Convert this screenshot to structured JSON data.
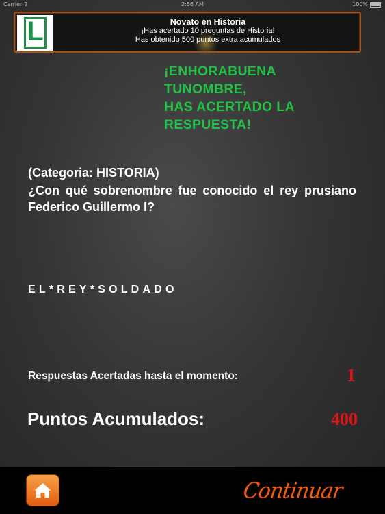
{
  "status_bar": {
    "carrier": "Carrier ⊽",
    "time": "2:56 AM",
    "battery": "100%"
  },
  "banner": {
    "badge_letter": "L",
    "title": "Novato en Historia",
    "line1": "¡Has acertado 10 preguntas de Historia!",
    "line2": "Has obtenido 500 puntos extra acumulados"
  },
  "congrats": {
    "line1": "¡ENHORABUENA",
    "line2": "TUNOMBRE,",
    "line3": "HAS ACERTADO LA",
    "line4": "RESPUESTA!"
  },
  "question": {
    "category": "(Categoria: HISTORIA)",
    "text": "¿Con qué sobrenombre fue conocido el rey prusiano Federico Guillermo I?"
  },
  "answer": "EL*REY*SOLDADO",
  "stats": {
    "correct_label": "Respuestas Acertadas hasta el momento:",
    "correct_value": "1",
    "points_label": "Puntos Acumulados:",
    "points_value": "400"
  },
  "bottom_bar": {
    "continue_label": "Continuar"
  },
  "colors": {
    "congrats": "#22c247",
    "values": "#e01515",
    "continue": "#ec5b12",
    "home": "#f08a32"
  }
}
